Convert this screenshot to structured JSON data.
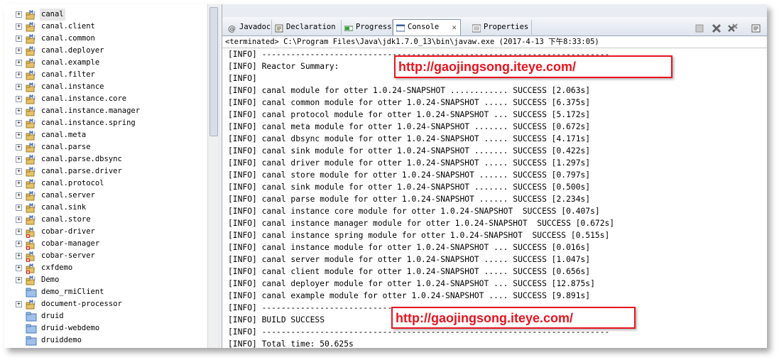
{
  "tree": {
    "items": [
      {
        "label": "canal",
        "icon": "maven-project-icon",
        "selected": true
      },
      {
        "label": "canal.client",
        "icon": "maven-project-icon"
      },
      {
        "label": "canal.common",
        "icon": "maven-project-icon"
      },
      {
        "label": "canal.deployer",
        "icon": "maven-project-icon"
      },
      {
        "label": "canal.example",
        "icon": "maven-project-icon"
      },
      {
        "label": "canal.filter",
        "icon": "maven-project-icon"
      },
      {
        "label": "canal.instance",
        "icon": "maven-project-icon"
      },
      {
        "label": "canal.instance.core",
        "icon": "maven-project-icon"
      },
      {
        "label": "canal.instance.manager",
        "icon": "maven-project-icon"
      },
      {
        "label": "canal.instance.spring",
        "icon": "maven-project-icon"
      },
      {
        "label": "canal.meta",
        "icon": "maven-project-icon"
      },
      {
        "label": "canal.parse",
        "icon": "maven-project-icon"
      },
      {
        "label": "canal.parse.dbsync",
        "icon": "maven-project-icon"
      },
      {
        "label": "canal.parse.driver",
        "icon": "maven-project-icon"
      },
      {
        "label": "canal.protocol",
        "icon": "maven-project-icon"
      },
      {
        "label": "canal.server",
        "icon": "maven-project-icon"
      },
      {
        "label": "canal.sink",
        "icon": "maven-project-icon"
      },
      {
        "label": "canal.store",
        "icon": "maven-project-icon"
      },
      {
        "label": "cobar-driver",
        "icon": "maven-project-error-icon"
      },
      {
        "label": "cobar-manager",
        "icon": "maven-project-error-icon"
      },
      {
        "label": "cobar-server",
        "icon": "maven-project-error-icon"
      },
      {
        "label": "cxfdemo",
        "icon": "maven-project-error-icon"
      },
      {
        "label": "Demo",
        "icon": "maven-project-icon"
      },
      {
        "label": "demo_rmiClient",
        "icon": "folder-icon",
        "noExpand": true
      },
      {
        "label": "document-processor",
        "icon": "maven-project-icon"
      },
      {
        "label": "druid",
        "icon": "folder-icon",
        "noExpand": true
      },
      {
        "label": "druid-webdemo",
        "icon": "folder-icon",
        "noExpand": true
      },
      {
        "label": "druiddemo",
        "icon": "folder-icon",
        "noExpand": true
      }
    ]
  },
  "tabs": [
    {
      "label": "Javadoc",
      "icon": "at-icon"
    },
    {
      "label": "Declaration",
      "icon": "declaration-icon"
    },
    {
      "label": "Progress",
      "icon": "progress-icon"
    },
    {
      "label": "Console",
      "icon": "console-icon",
      "active": true,
      "close": "✕"
    },
    {
      "label": "Properties",
      "icon": "properties-icon"
    }
  ],
  "console": {
    "header": "<terminated> C:\\Program Files\\Java\\jdk1.7.0_13\\bin\\javaw.exe (2017-4-13 下午8:33:05)",
    "lines": [
      "[INFO] ------------------------------------------------------------------------",
      "[INFO] Reactor Summary:",
      "[INFO]",
      "[INFO] canal module for otter 1.0.24-SNAPSHOT ............ SUCCESS [2.063s]",
      "[INFO] canal common module for otter 1.0.24-SNAPSHOT ..... SUCCESS [6.375s]",
      "[INFO] canal protocol module for otter 1.0.24-SNAPSHOT ... SUCCESS [5.172s]",
      "[INFO] canal meta module for otter 1.0.24-SNAPSHOT ....... SUCCESS [0.672s]",
      "[INFO] canal dbsync module for otter 1.0.24-SNAPSHOT ..... SUCCESS [4.171s]",
      "[INFO] canal sink module for otter 1.0.24-SNAPSHOT ....... SUCCESS [0.422s]",
      "[INFO] canal driver module for otter 1.0.24-SNAPSHOT ..... SUCCESS [1.297s]",
      "[INFO] canal store module for otter 1.0.24-SNAPSHOT ...... SUCCESS [0.797s]",
      "[INFO] canal sink module for otter 1.0.24-SNAPSHOT ....... SUCCESS [0.500s]",
      "[INFO] canal parse module for otter 1.0.24-SNAPSHOT ...... SUCCESS [2.234s]",
      "[INFO] canal instance core module for otter 1.0.24-SNAPSHOT  SUCCESS [0.407s]",
      "[INFO] canal instance manager module for otter 1.0.24-SNAPSHOT  SUCCESS [0.672s]",
      "[INFO] canal instance spring module for otter 1.0.24-SNAPSHOT  SUCCESS [0.515s]",
      "[INFO] canal instance module for otter 1.0.24-SNAPSHOT ... SUCCESS [0.016s]",
      "[INFO] canal server module for otter 1.0.24-SNAPSHOT ..... SUCCESS [1.047s]",
      "[INFO] canal client module for otter 1.0.24-SNAPSHOT ..... SUCCESS [0.656s]",
      "[INFO] canal deployer module for otter 1.0.24-SNAPSHOT ... SUCCESS [12.875s]",
      "[INFO] canal example module for otter 1.0.24-SNAPSHOT .... SUCCESS [9.891s]",
      "[INFO] ------------------------------------------------------------------------",
      "[INFO] BUILD SUCCESS",
      "[INFO] ------------------------------------------------------------------------",
      "[INFO] Total time: 50.625s"
    ]
  },
  "watermarks": [
    {
      "text": "http://gaojingsong.iteye.com/"
    },
    {
      "text": "http://gaojingsong.iteye.com/"
    }
  ],
  "colors": {
    "watermark": "#e8141e",
    "tab_bar": "#dfe5ee",
    "selection": "#e7e7e7"
  }
}
